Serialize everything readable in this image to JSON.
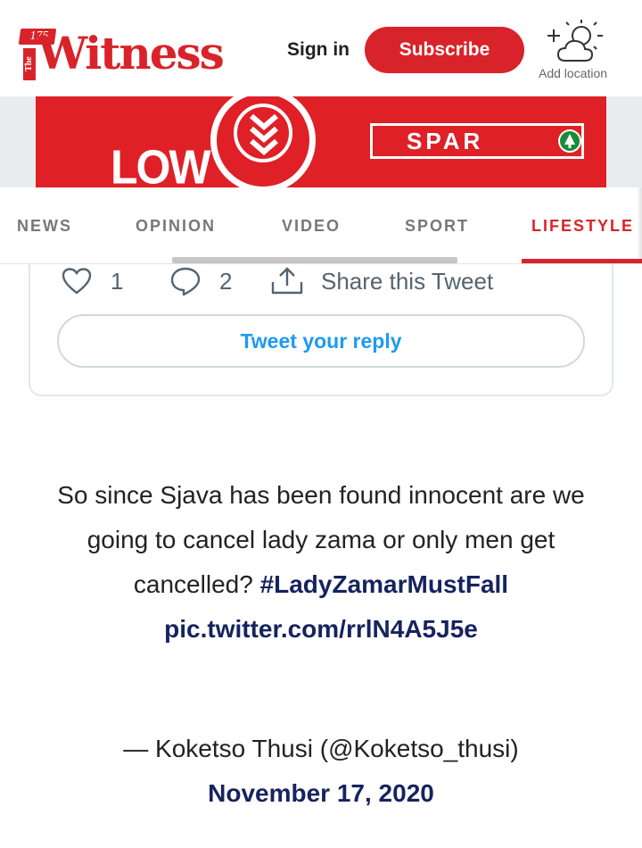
{
  "header": {
    "logo_number": "175",
    "logo_the": "The",
    "logo_word": "Witness",
    "sign_in": "Sign in",
    "subscribe": "Subscribe",
    "add_location": "Add location",
    "weather_icon": "partly-cloudy-icon"
  },
  "ad": {
    "low_text": "LOW",
    "brand_text": "SPAR"
  },
  "nav": {
    "items": [
      {
        "label": "NEWS"
      },
      {
        "label": "OPINION"
      },
      {
        "label": "VIDEO"
      },
      {
        "label": "SPORT"
      },
      {
        "label": "LIFESTYLE"
      }
    ],
    "active": "LIFESTYLE"
  },
  "tweet": {
    "likes": "1",
    "replies": "2",
    "share_label": "Share this Tweet",
    "reply_button": "Tweet your reply"
  },
  "quote": {
    "text": "So since Sjava has been found innocent are we going to cancel lady zama or only men get cancelled?",
    "hashtag": "#LadyZamarMustFall",
    "link": "pic.twitter.com/rrlN4A5J5e",
    "attribution": "— Koketso Thusi (@Koketso_thusi)",
    "date": "November 17, 2020"
  },
  "colors": {
    "brand_red": "#d9232a",
    "link_navy": "#16235e",
    "twitter_blue": "#1d9bf0"
  }
}
